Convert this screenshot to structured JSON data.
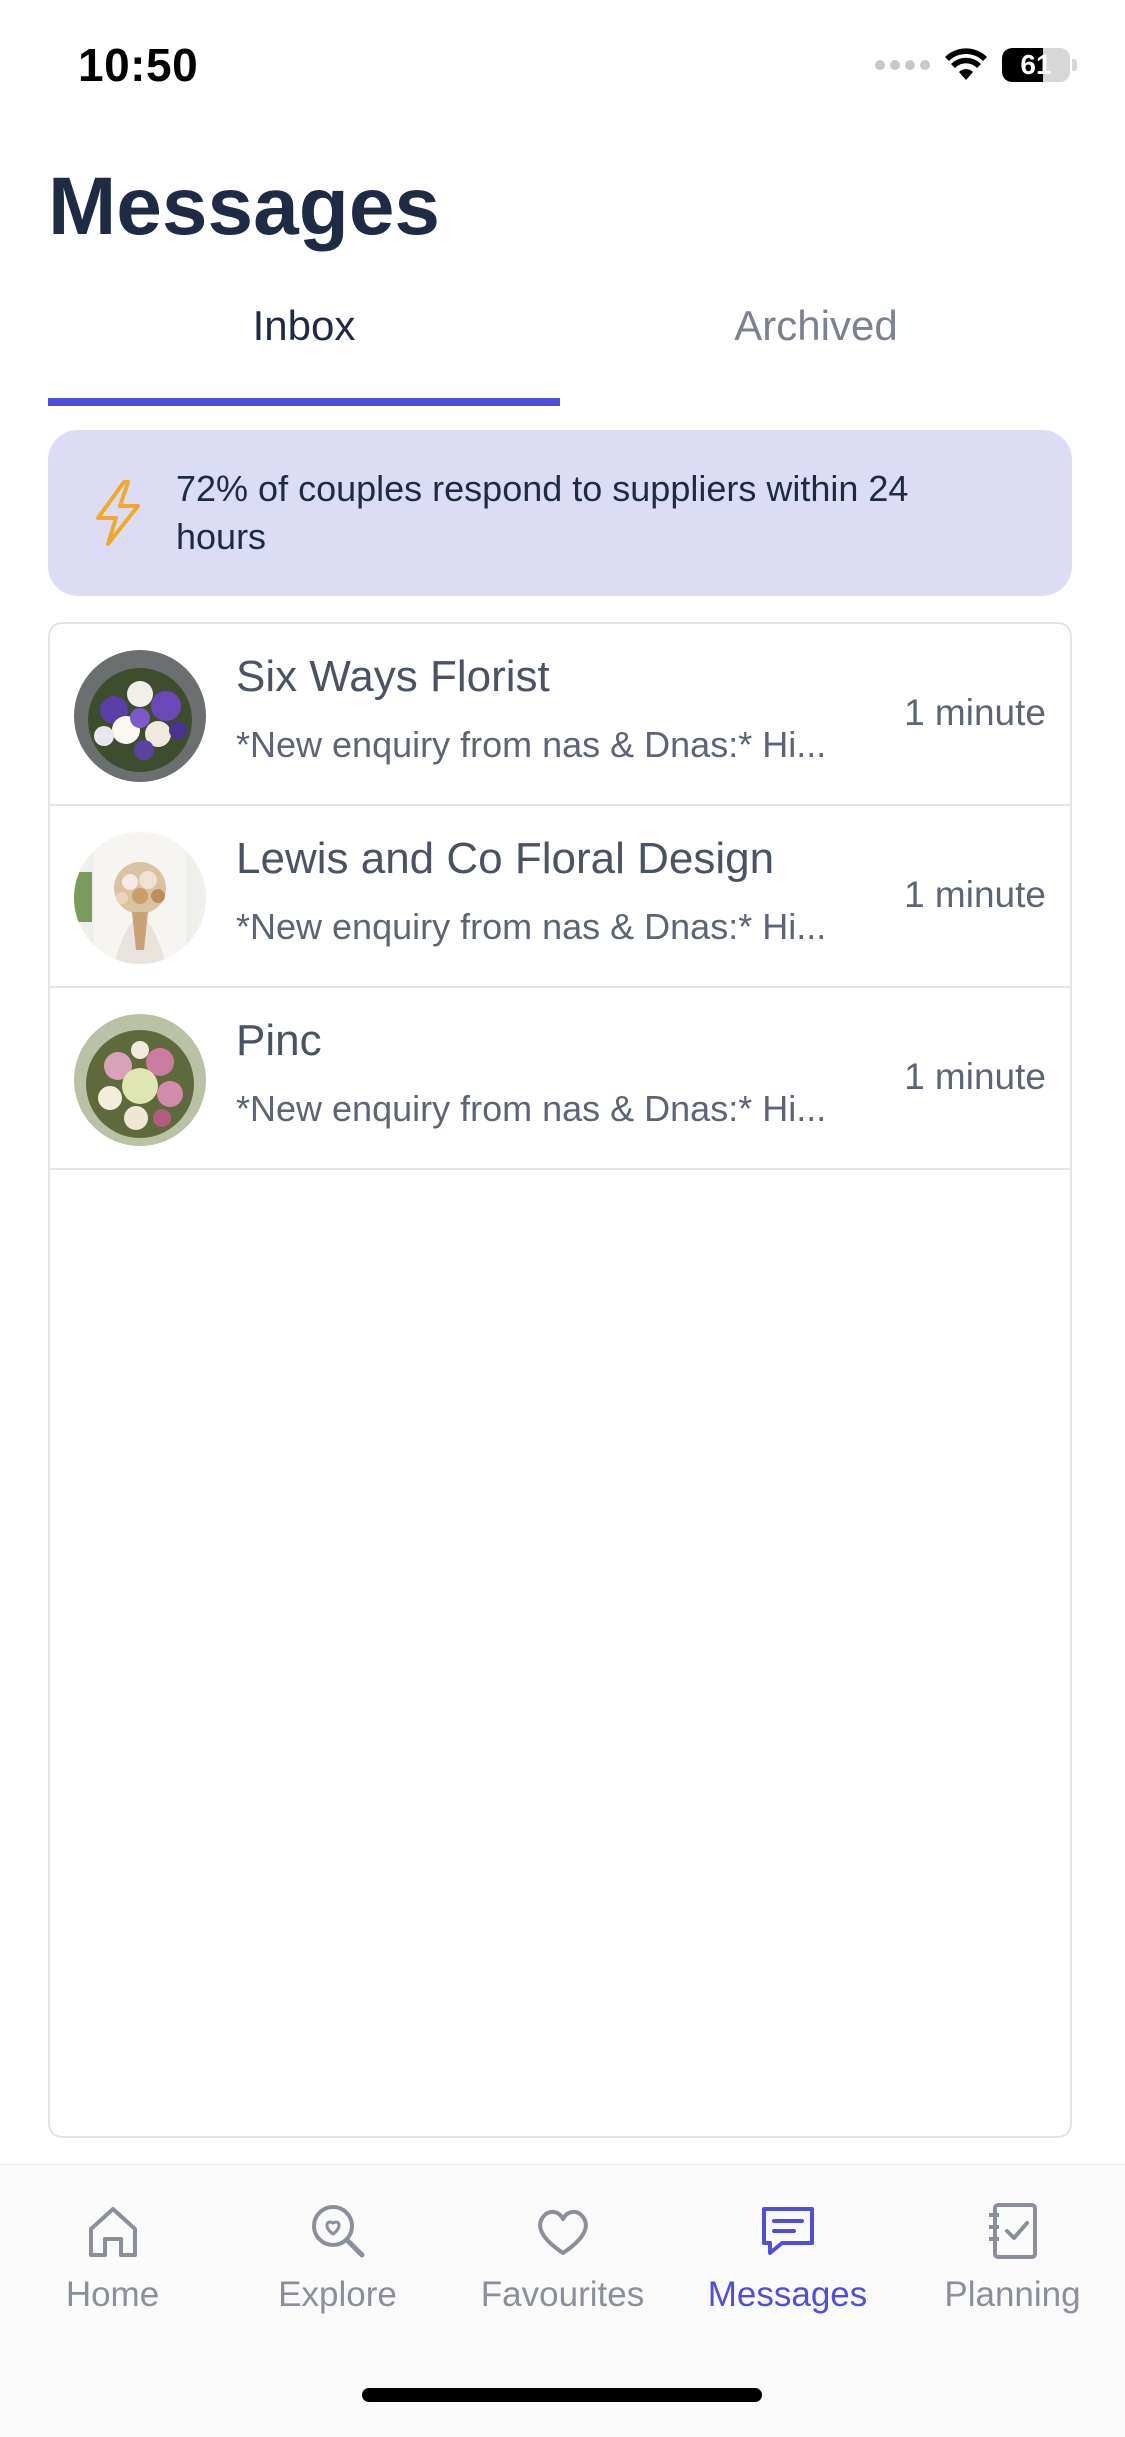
{
  "status_bar": {
    "time": "10:50",
    "battery_level": "61"
  },
  "header": {
    "title": "Messages"
  },
  "tabs": [
    {
      "label": "Inbox",
      "active": true
    },
    {
      "label": "Archived",
      "active": false
    }
  ],
  "banner": {
    "icon": "lightning-icon",
    "text": "72% of couples respond to suppliers within 24 hours"
  },
  "conversations": [
    {
      "name": "Six Ways Florist",
      "preview": "*New enquiry from nas & Dnas:* Hi...",
      "time": "1 minute",
      "avatar": "bouquet-purple-white"
    },
    {
      "name": "Lewis and Co Floral Design",
      "preview": "*New enquiry from nas & Dnas:* Hi...",
      "time": "1 minute",
      "avatar": "bouquet-dried-neutral"
    },
    {
      "name": "Pinc",
      "preview": "*New enquiry from nas & Dnas:* Hi...",
      "time": "1 minute",
      "avatar": "bouquet-pink-roses"
    }
  ],
  "bottom_nav": [
    {
      "label": "Home",
      "icon": "home-icon",
      "active": false
    },
    {
      "label": "Explore",
      "icon": "explore-icon",
      "active": false
    },
    {
      "label": "Favourites",
      "icon": "heart-icon",
      "active": false
    },
    {
      "label": "Messages",
      "icon": "chat-icon",
      "active": true
    },
    {
      "label": "Planning",
      "icon": "checklist-icon",
      "active": false
    }
  ],
  "colors": {
    "accent": "#4f4fd9",
    "banner_bg": "#dcdcf7",
    "title": "#1f2a44",
    "muted": "#8a8f9b"
  }
}
